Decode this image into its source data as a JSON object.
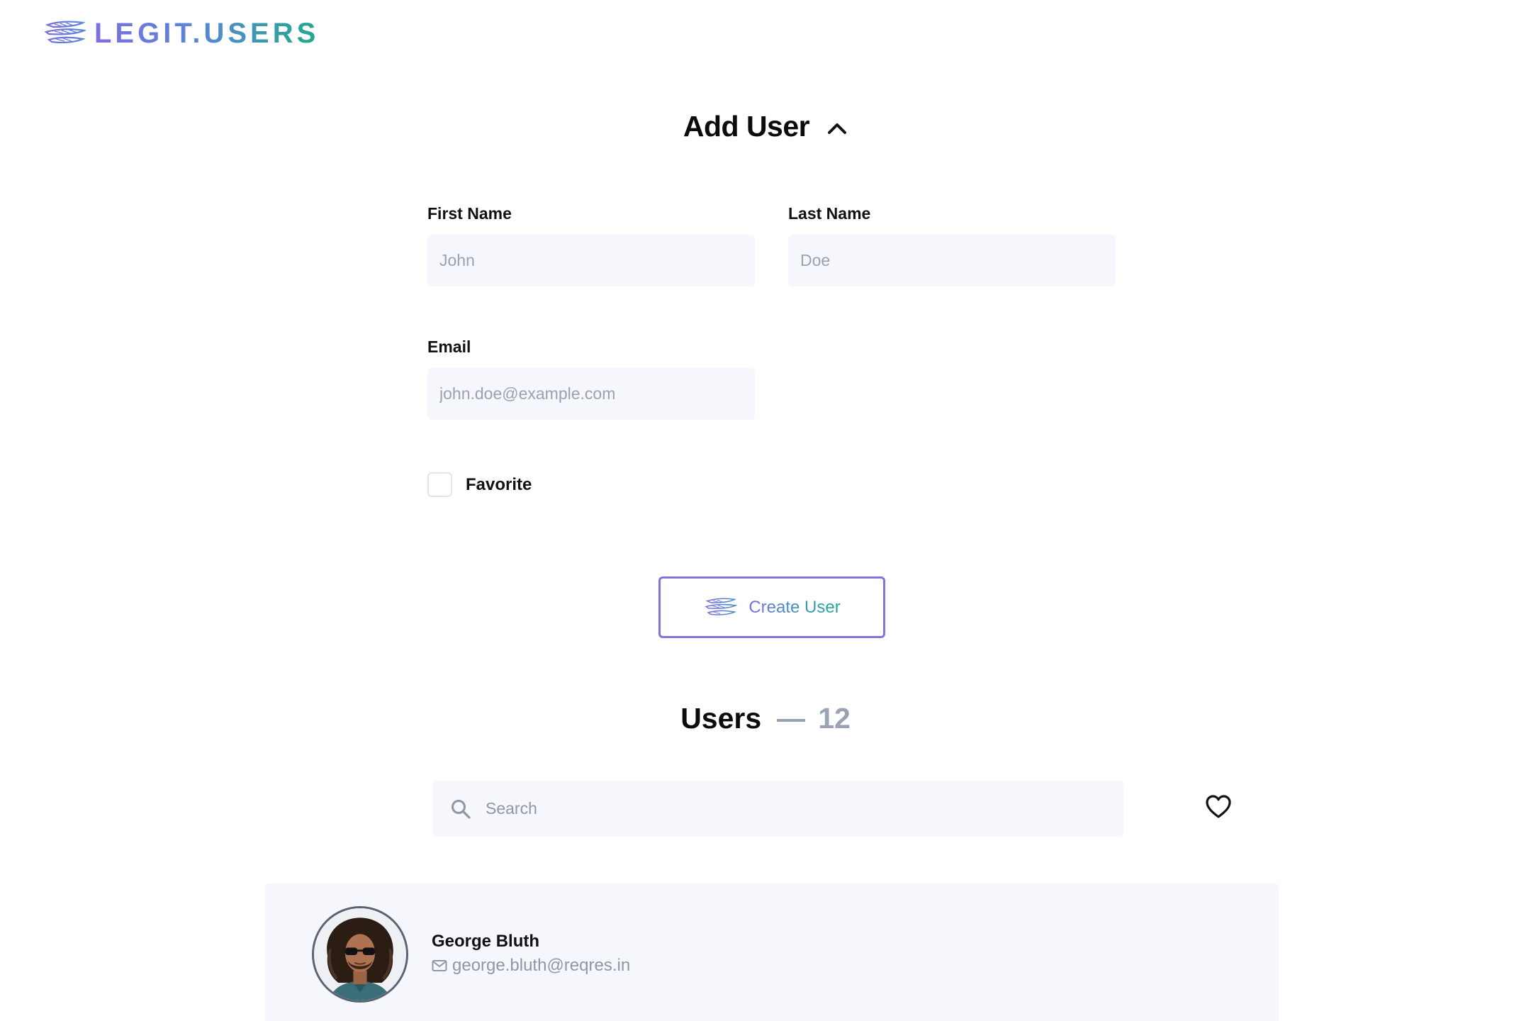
{
  "app": {
    "logo_text": "LEGIT.USERS",
    "brand_colors": {
      "start": "#7c6fe0",
      "end": "#22a98b"
    }
  },
  "add_user": {
    "title": "Add User",
    "toggle_icon": "chevron-up-icon",
    "first_name": {
      "label": "First Name",
      "placeholder": "John",
      "value": ""
    },
    "last_name": {
      "label": "Last Name",
      "placeholder": "Doe",
      "value": ""
    },
    "email": {
      "label": "Email",
      "placeholder": "john.doe@example.com",
      "value": ""
    },
    "favorite": {
      "label": "Favorite",
      "checked": false
    },
    "submit_label": "Create User"
  },
  "users": {
    "title": "Users",
    "count": "12",
    "search": {
      "placeholder": "Search",
      "value": "",
      "icon": "search-icon"
    },
    "favorites_filter_icon": "heart-icon",
    "list": [
      {
        "name": "George Bluth",
        "email": "george.bluth@reqres.in"
      }
    ]
  }
}
